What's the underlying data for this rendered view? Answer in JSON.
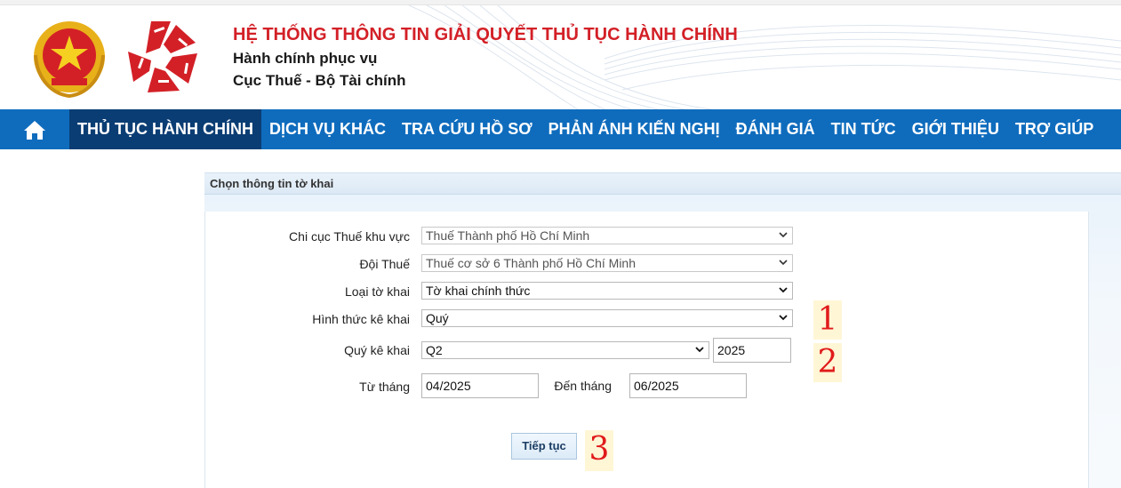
{
  "header": {
    "system_title": "HỆ THỐNG THÔNG TIN GIẢI QUYẾT THỦ TỤC HÀNH CHÍNH",
    "subtitle_1": "Hành chính phục vụ",
    "subtitle_2": "Cục Thuế - Bộ Tài chính",
    "emblem_icon": "vietnam-national-emblem-icon",
    "logo_icon": "public-service-logo-icon"
  },
  "nav": {
    "home_icon": "home-icon",
    "items": [
      {
        "label": "THỦ TỤC HÀNH CHÍNH",
        "active": true
      },
      {
        "label": "DỊCH VỤ KHÁC",
        "active": false
      },
      {
        "label": "TRA CỨU HỒ SƠ",
        "active": false
      },
      {
        "label": "PHẢN ÁNH KIẾN NGHỊ",
        "active": false
      },
      {
        "label": "ĐÁNH GIÁ",
        "active": false
      },
      {
        "label": "TIN TỨC",
        "active": false
      },
      {
        "label": "GIỚI THIỆU",
        "active": false
      },
      {
        "label": "TRỢ GIÚP",
        "active": false
      }
    ]
  },
  "panel": {
    "title": "Chọn thông tin tờ khai"
  },
  "form": {
    "chi_cuc": {
      "label": "Chi cục Thuế khu vực",
      "value": "Thuế Thành phố Hồ Chí Minh"
    },
    "doi_thue": {
      "label": "Đội Thuế",
      "value": "Thuế cơ sở 6 Thành phố Hồ Chí Minh"
    },
    "loai_to_khai": {
      "label": "Loại tờ khai",
      "value": "Tờ khai chính thức"
    },
    "hinh_thuc": {
      "label": "Hình thức kê khai",
      "value": "Quý"
    },
    "quy_ke_khai": {
      "label": "Quý kê khai",
      "value": "Q2",
      "year": "2025"
    },
    "tu_thang": {
      "label": "Từ tháng",
      "value": "04/2025"
    },
    "den_thang": {
      "label": "Đến tháng",
      "value": "06/2025"
    },
    "submit_label": "Tiếp tục"
  },
  "annotations": {
    "mark_1": "1",
    "mark_2": "2",
    "mark_3": "3"
  },
  "colors": {
    "title_red": "#d32027",
    "nav_blue": "#0f6cbd",
    "nav_active": "#0a3d73",
    "annotation_red": "#e11b1b",
    "annotation_bg": "#fff6d6"
  }
}
